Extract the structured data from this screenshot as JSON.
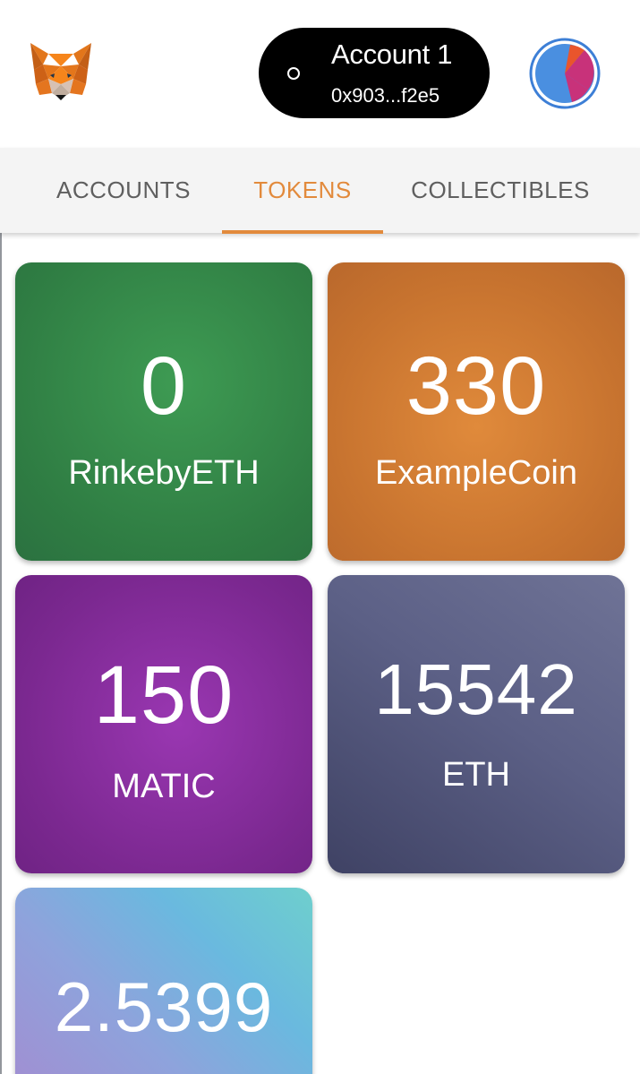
{
  "header": {
    "account_name": "Account 1",
    "account_address": "0x903...f2e5"
  },
  "tabs": [
    {
      "label": "ACCOUNTS",
      "active": false
    },
    {
      "label": "TOKENS",
      "active": true
    },
    {
      "label": "COLLECTIBLES",
      "active": false
    }
  ],
  "tokens": [
    {
      "amount": "0",
      "symbol": "RinkebyETH",
      "color": "#348847"
    },
    {
      "amount": "330",
      "symbol": "ExampleCoin",
      "color": "#d07b34"
    },
    {
      "amount": "150",
      "symbol": "MATIC",
      "color": "#84309b"
    },
    {
      "amount": "15542",
      "symbol": "ETH",
      "color": "#575b80"
    },
    {
      "amount": "2.5399",
      "symbol": "",
      "color": "#7fb3de"
    }
  ],
  "colors": {
    "accent": "#e28a3c",
    "pill_background": "#000000",
    "tab_background": "#f4f4f4"
  }
}
